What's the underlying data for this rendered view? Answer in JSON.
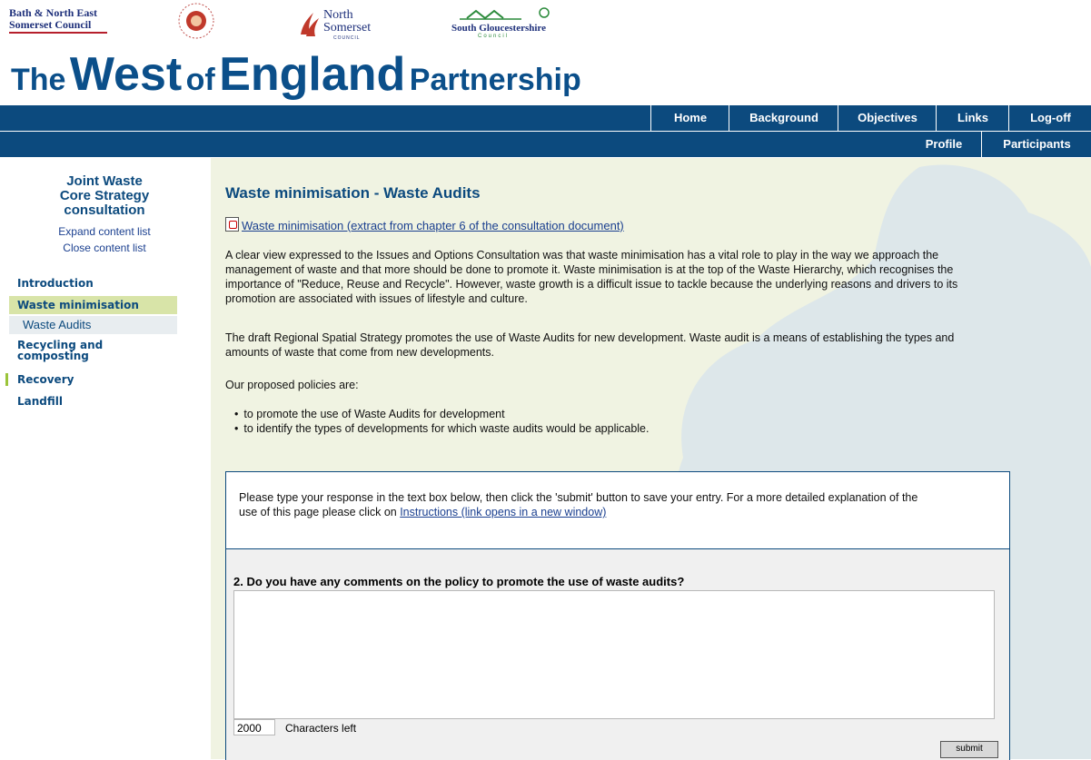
{
  "header": {
    "logos": {
      "bnes_line1": "Bath & North East",
      "bnes_line2": "Somerset Council",
      "north_somerset_line1": "North",
      "north_somerset_line2": "Somerset",
      "north_somerset_sub": "COUNCIL",
      "south_glos": "South Gloucestershire",
      "south_glos_sub": "Council",
      "bristol_ring": "BRISTOL CITY COUNCIL"
    },
    "title_the": "The",
    "title_west": "West",
    "title_of": "of",
    "title_england": "England",
    "title_partnership": "Partnership"
  },
  "nav": {
    "primary": [
      "Home",
      "Background",
      "Objectives",
      "Links",
      "Log-off"
    ],
    "secondary": [
      "Profile",
      "Participants"
    ]
  },
  "sidebar": {
    "title_line1": "Joint Waste",
    "title_line2": "Core Strategy",
    "title_line3": "consultation",
    "expand": "Expand content list",
    "close": "Close content list",
    "items": [
      {
        "label": "Introduction"
      },
      {
        "label": "Waste minimisation"
      },
      {
        "label": "Waste Audits"
      },
      {
        "label": "Recycling and composting"
      },
      {
        "label": "Recovery"
      },
      {
        "label": "Landfill"
      }
    ]
  },
  "main": {
    "heading": "Waste minimisation - Waste Audits",
    "pdf_link": "Waste minimisation (extract from chapter 6 of the consultation document)",
    "para1": "A clear view expressed to the Issues and Options Consultation was that waste minimisation has a vital role to play in the way we approach the management of waste and that more should be done to promote it. Waste minimisation is at the top of the Waste Hierarchy, which recognises the importance of \"Reduce, Reuse and Recycle\". However, waste growth is a difficult issue to tackle because the underlying reasons and drivers to its promotion are associated with issues of lifestyle and culture.",
    "para2": "The draft Regional Spatial Strategy promotes the use of Waste Audits for new development. Waste audit is a means of establishing the types and amounts of waste that come from new developments.",
    "para3": "Our proposed policies are:",
    "bullets": [
      "to promote the use of Waste Audits for development",
      "to identify the types of developments for which waste audits would be applicable."
    ]
  },
  "form": {
    "intro": "Please type your response in the text box below, then click the 'submit' button to save your entry. For a more detailed explanation of the use of this page please click on",
    "instructions_link": "Instructions (link opens in a new window)",
    "question": "2. Do you have any comments on the policy to promote the use of waste audits?",
    "answer_value": "",
    "chars_left": "2000",
    "chars_left_label": "Characters left",
    "submit_label": "submit"
  },
  "colors": {
    "nav_bg": "#0c4a7e",
    "content_bg": "#f0f3e2",
    "active_menu": "#d8e4a8",
    "accent_green": "#9bc43a"
  }
}
